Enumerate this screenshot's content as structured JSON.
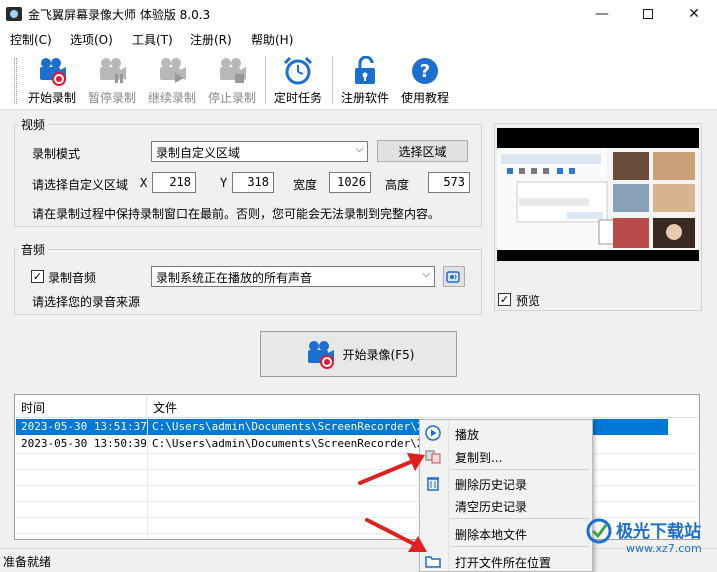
{
  "window": {
    "title": "金飞翼屏幕录像大师 体验版 8.0.3"
  },
  "menubar": {
    "items": [
      "控制(C)",
      "选项(O)",
      "工具(T)",
      "注册(R)",
      "帮助(H)"
    ]
  },
  "toolbar": {
    "start": "开始录制",
    "pause": "暂停录制",
    "resume": "继续录制",
    "stop": "停止录制",
    "schedule": "定时任务",
    "register": "注册软件",
    "help": "使用教程"
  },
  "video": {
    "group_label": "视频",
    "mode_label": "录制模式",
    "mode_value": "录制自定义区域",
    "select_area_button": "选择区域",
    "area_label": "请选择自定义区域",
    "x_label": "X",
    "x_value": "218",
    "y_label": "Y",
    "y_value": "318",
    "width_label": "宽度",
    "width_value": "1026",
    "height_label": "高度",
    "height_value": "573",
    "note": "请在录制过程中保持录制窗口在最前。否则，您可能会无法录制到完整内容。"
  },
  "audio": {
    "group_label": "音频",
    "record_audio_label": "录制音频",
    "record_audio_checked": true,
    "source_value": "录制系统正在播放的所有声音",
    "source_hint": "请选择您的录音来源"
  },
  "preview": {
    "label": "预览",
    "checked": true
  },
  "big_record_button": "开始录像(F5)",
  "history": {
    "columns": [
      "时间",
      "文件"
    ],
    "rows": [
      {
        "time": "2023-05-30 13:51:37",
        "file": "C:\\Users\\admin\\Documents\\ScreenRecorder\\2023",
        "selected": true
      },
      {
        "time": "2023-05-30 13:50:39",
        "file": "C:\\Users\\admin\\Documents\\ScreenRecorder\\2023",
        "selected": false
      }
    ]
  },
  "status": {
    "text": "准备就绪"
  },
  "context_menu": {
    "items": [
      "播放",
      "复制到...",
      "删除历史记录",
      "清空历史记录",
      "删除本地文件",
      "打开文件所在位置"
    ]
  },
  "watermark": {
    "brand": "极光下载站",
    "url": "www.xz7.com"
  },
  "colors": {
    "accent_blue": "#1a6fd0",
    "record_red": "#e0182d",
    "selection": "#0078d7",
    "arrow_red": "#e02020"
  }
}
